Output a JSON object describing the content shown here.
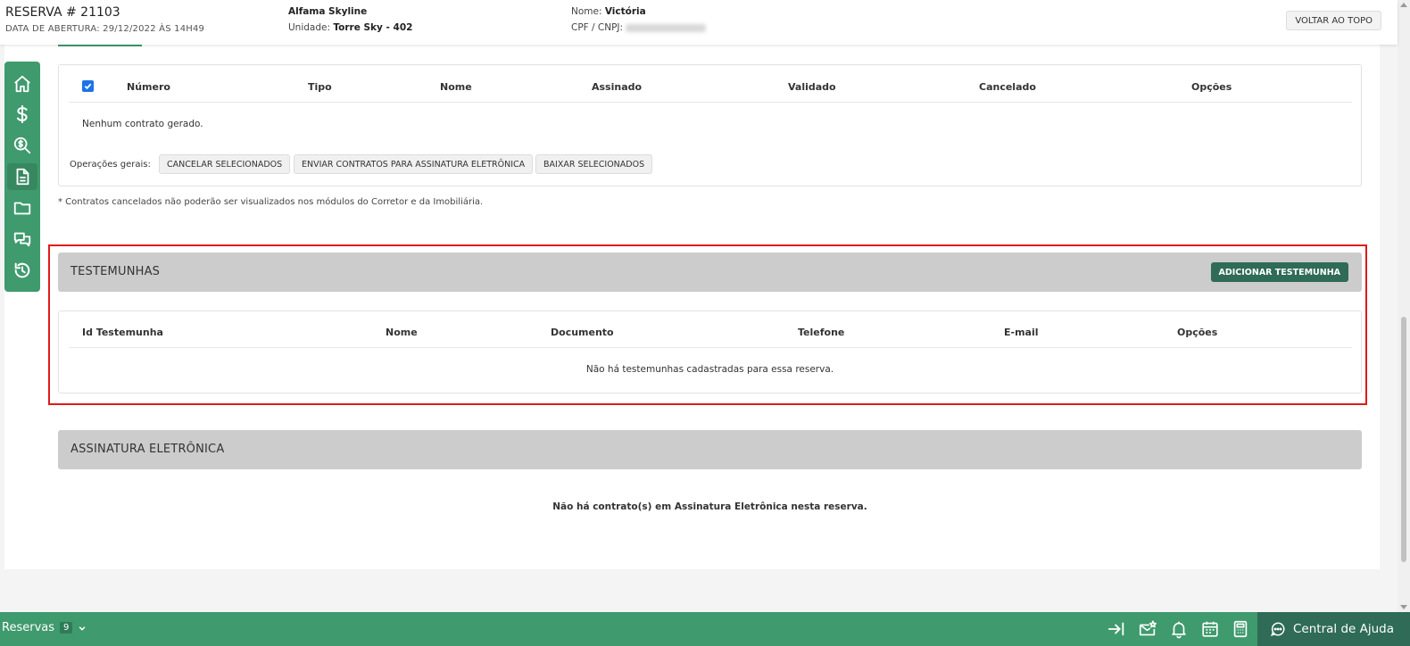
{
  "header": {
    "title": "RESERVA # 21103",
    "opening_date": "DATA DE ABERTURA: 29/12/2022 ÀS 14H49",
    "project": "Alfama Skyline",
    "unit_label": "Unidade: ",
    "unit_value": "Torre Sky - 402",
    "name_label": "Nome: ",
    "name_value": "Victória",
    "cpf_label": "CPF / CNPJ: ",
    "back_to_top": "VOLTAR AO TOPO"
  },
  "contracts": {
    "columns": [
      "Número",
      "Tipo",
      "Nome",
      "Assinado",
      "Validado",
      "Cancelado",
      "Opções"
    ],
    "empty_message": "Nenhum contrato gerado.",
    "operations_label": "Operações gerais:",
    "buttons": {
      "cancel_selected": "CANCELAR SELECIONADOS",
      "send_signature": "ENVIAR CONTRATOS PARA ASSINATURA ELETRÔNICA",
      "download_selected": "BAIXAR SELECIONADOS"
    },
    "note": "* Contratos cancelados não poderão ser visualizados nos módulos do Corretor e da Imobiliária."
  },
  "witnesses": {
    "title": "TESTEMUNHAS",
    "add_button": "ADICIONAR TESTEMUNHA",
    "columns": [
      "Id Testemunha",
      "Nome",
      "Documento",
      "Telefone",
      "E-mail",
      "Opções"
    ],
    "empty_message": "Não há testemunhas cadastradas para essa reserva."
  },
  "signature": {
    "title": "ASSINATURA ELETRÔNICA",
    "empty_message": "Não há contrato(s) em Assinatura Eletrônica nesta reserva."
  },
  "sidebar": {
    "items": [
      "home-icon",
      "dollar-icon",
      "search-money-icon",
      "document-icon",
      "folder-icon",
      "chat-icon",
      "history-icon"
    ],
    "active": "document-icon"
  },
  "bottombar": {
    "reservas_label": "Reservas",
    "reservas_count": "9",
    "help_label": "Central de Ajuda"
  },
  "colors": {
    "brand_green": "#3f9a6e",
    "dark_green": "#2f6b57",
    "highlight_red": "#e01a1a"
  }
}
